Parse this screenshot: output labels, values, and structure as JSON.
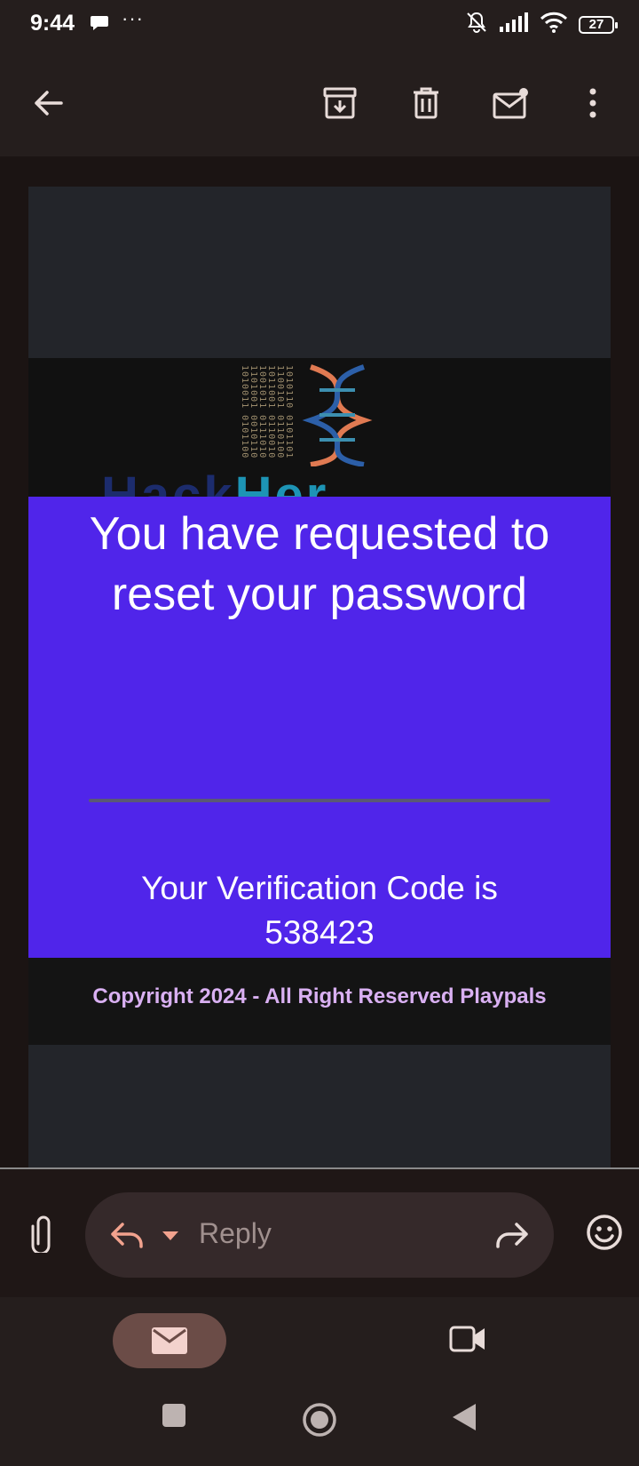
{
  "status_bar": {
    "time": "9:44",
    "extra": "···",
    "battery": "27"
  },
  "email": {
    "brand_left": "Hack",
    "brand_right": "Her",
    "binary_text": "1010110 0101101 1100101 0110100 1011001 0110010 1001011 0111010 1101001 0010110 1010011 0101100",
    "headline": "You have requested to reset your password",
    "code_line1": "Your Verification Code is",
    "code_value": "538423",
    "copyright": "Copyright 2024 - All Right Reserved Playpals"
  },
  "reply": {
    "placeholder": "Reply"
  },
  "colors": {
    "accent_purple": "#5025ea",
    "copyright_color": "#d9b0f2",
    "reply_accent": "#f2a28e"
  }
}
